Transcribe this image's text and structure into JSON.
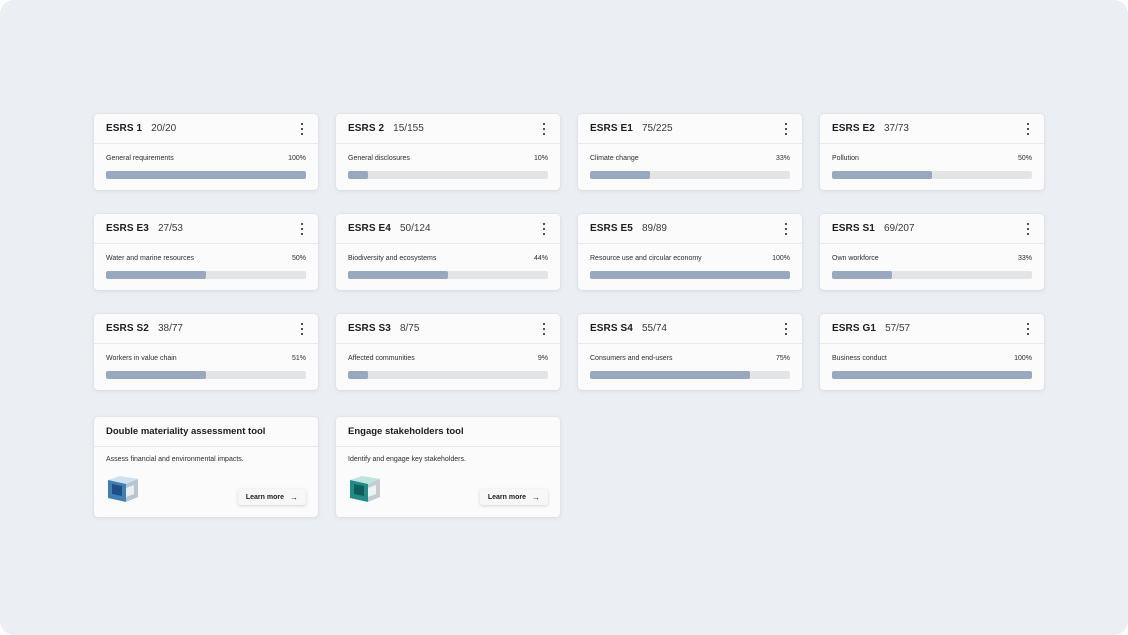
{
  "cards": [
    {
      "code": "ESRS 1",
      "count": "20/20",
      "label": "General requirements",
      "percent_text": "100%",
      "progress": 1.0
    },
    {
      "code": "ESRS 2",
      "count": "15/155",
      "label": "General disclosures",
      "percent_text": "10%",
      "progress": 0.1
    },
    {
      "code": "ESRS E1",
      "count": "75/225",
      "label": "Climate change",
      "percent_text": "33%",
      "progress": 0.3
    },
    {
      "code": "ESRS E2",
      "count": "37/73",
      "label": "Pollution",
      "percent_text": "50%",
      "progress": 0.5
    },
    {
      "code": "ESRS E3",
      "count": "27/53",
      "label": "Water and marine resources",
      "percent_text": "50%",
      "progress": 0.5
    },
    {
      "code": "ESRS E4",
      "count": "50/124",
      "label": "Biodiversity and ecosystems",
      "percent_text": "44%",
      "progress": 0.5
    },
    {
      "code": "ESRS E5",
      "count": "89/89",
      "label": "Resource use and circular economy",
      "percent_text": "100%",
      "progress": 1.0
    },
    {
      "code": "ESRS S1",
      "count": "69/207",
      "label": "Own workforce",
      "percent_text": "33%",
      "progress": 0.3
    },
    {
      "code": "ESRS S2",
      "count": "38/77",
      "label": "Workers in value chain",
      "percent_text": "51%",
      "progress": 0.5
    },
    {
      "code": "ESRS S3",
      "count": "8/75",
      "label": "Affected communities",
      "percent_text": "9%",
      "progress": 0.1
    },
    {
      "code": "ESRS S4",
      "count": "55/74",
      "label": "Consumers and end-users",
      "percent_text": "75%",
      "progress": 0.8
    },
    {
      "code": "ESRS G1",
      "count": "57/57",
      "label": "Business conduct",
      "percent_text": "100%",
      "progress": 1.0
    }
  ],
  "tools": [
    {
      "title": "Double materiality assessment tool",
      "description": "Assess financial and environmental impacts.",
      "button_label": "Learn more",
      "icon": "blue-cube-icon"
    },
    {
      "title": "Engage stakeholders tool",
      "description": "Identify and engage key stakeholders.",
      "button_label": "Learn more",
      "icon": "teal-cube-icon"
    }
  ],
  "colors": {
    "progress_fill": "#98a8bf",
    "progress_track": "#e3e4e6",
    "background": "#ebeef2"
  },
  "icons": {
    "menu": "kebab-menu-icon",
    "arrow": "arrow-right-icon"
  }
}
